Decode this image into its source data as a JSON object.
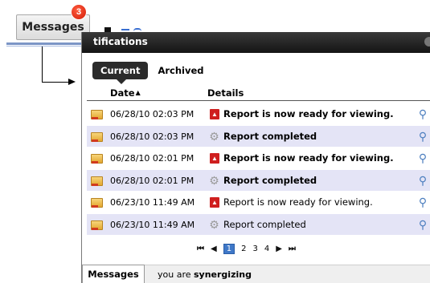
{
  "top_tab": {
    "label": "Messages",
    "badge": "3"
  },
  "panel": {
    "title": "tifications",
    "tabs": [
      {
        "label": "Current",
        "active": true
      },
      {
        "label": "Archived",
        "active": false
      }
    ],
    "columns": {
      "date": "Date",
      "details": "Details"
    },
    "rows": [
      {
        "date": "06/28/10 02:03 PM",
        "icon": "pdf-report-icon",
        "details": "Report is now ready for viewing.",
        "bold": true
      },
      {
        "date": "06/28/10 02:03 PM",
        "icon": "gear-icon",
        "details": "Report completed",
        "bold": true
      },
      {
        "date": "06/28/10 02:01 PM",
        "icon": "pdf-report-icon",
        "details": "Report is now ready for viewing.",
        "bold": true
      },
      {
        "date": "06/28/10 02:01 PM",
        "icon": "gear-icon",
        "details": "Report completed",
        "bold": true
      },
      {
        "date": "06/23/10 11:49 AM",
        "icon": "pdf-report-icon",
        "details": "Report is now ready for viewing.",
        "bold": false
      },
      {
        "date": "06/23/10 11:49 AM",
        "icon": "gear-icon",
        "details": "Report completed",
        "bold": false
      }
    ],
    "pager": {
      "pages": [
        "1",
        "2",
        "3",
        "4"
      ],
      "current": "1"
    },
    "footer": {
      "tab_label": "Messages",
      "status_prefix": "you are",
      "status_value": "synergizing"
    }
  },
  "colors": {
    "title_bar": "#1e1e1e",
    "row_alt": "#e4e4f6",
    "badge": "#d31e09",
    "page_current": "#3f78c8"
  }
}
